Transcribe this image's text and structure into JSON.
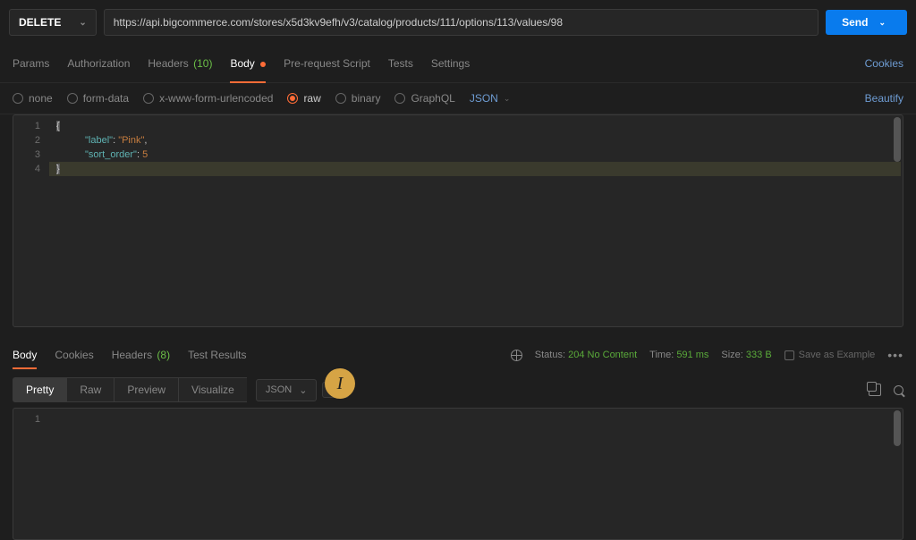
{
  "request": {
    "method": "DELETE",
    "url": "https://api.bigcommerce.com/stores/x5d3kv9efh/v3/catalog/products/111/options/113/values/98",
    "send_label": "Send"
  },
  "reqTabs": {
    "params": "Params",
    "authorization": "Authorization",
    "headers": "Headers",
    "headers_count": "(10)",
    "body": "Body",
    "prerequest": "Pre-request Script",
    "tests": "Tests",
    "settings": "Settings",
    "cookies": "Cookies"
  },
  "bodyTypes": {
    "none": "none",
    "formdata": "form-data",
    "xwww": "x-www-form-urlencoded",
    "raw": "raw",
    "binary": "binary",
    "graphql": "GraphQL",
    "json": "JSON",
    "beautify": "Beautify"
  },
  "editor": {
    "lines": [
      "1",
      "2",
      "3",
      "4"
    ],
    "l1_brace": "{",
    "l2_key": "\"label\"",
    "l2_colon": ": ",
    "l2_val": "\"Pink\"",
    "l2_comma": ",",
    "l3_key": "\"sort_order\"",
    "l3_colon": ": ",
    "l3_val": "5",
    "l4_brace": "}"
  },
  "resTabs": {
    "body": "Body",
    "cookies": "Cookies",
    "headers": "Headers",
    "headers_count": "(8)",
    "testresults": "Test Results"
  },
  "status": {
    "status_label": "Status:",
    "status_value": "204 No Content",
    "time_label": "Time:",
    "time_value": "591 ms",
    "size_label": "Size:",
    "size_value": "333 B",
    "save_example": "Save as Example"
  },
  "viewTabs": {
    "pretty": "Pretty",
    "raw": "Raw",
    "preview": "Preview",
    "visualize": "Visualize",
    "format": "JSON"
  },
  "resEditor": {
    "line1": "1"
  },
  "cursor": "I"
}
